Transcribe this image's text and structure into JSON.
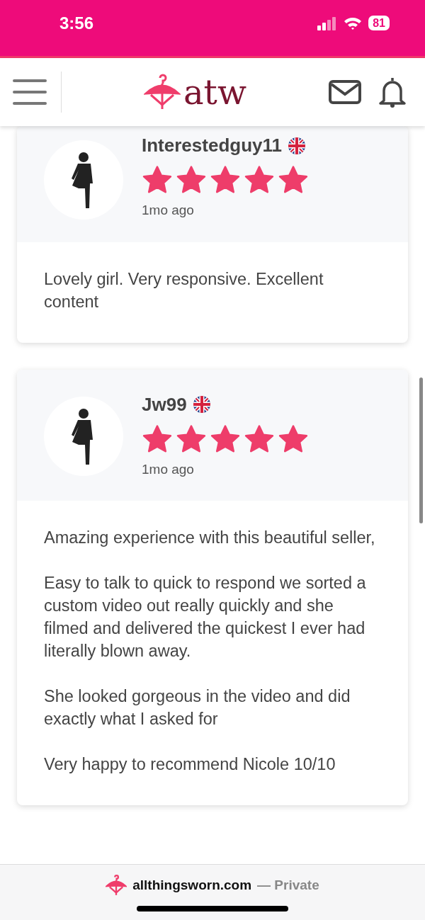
{
  "status_bar": {
    "time": "3:56",
    "battery": "81"
  },
  "header": {
    "logo_text": "atw"
  },
  "reviews": [
    {
      "username": "Interestedguy11",
      "stars": 5,
      "time": "1mo ago",
      "paragraphs": [
        "Lovely girl. Very responsive. Excellent content"
      ]
    },
    {
      "username": "Jw99",
      "stars": 5,
      "time": "1mo ago",
      "paragraphs": [
        "Amazing experience with this beautiful seller,",
        "Easy to talk to quick to respond we sorted a custom video out really quickly and she filmed and delivered the quickest I ever had literally blown away.",
        "She looked gorgeous in the video and did exactly what I asked for",
        "Very happy to recommend Nicole 10/10"
      ]
    }
  ],
  "browser_bar": {
    "domain": "allthingsworn.com",
    "mode": "— Private"
  }
}
